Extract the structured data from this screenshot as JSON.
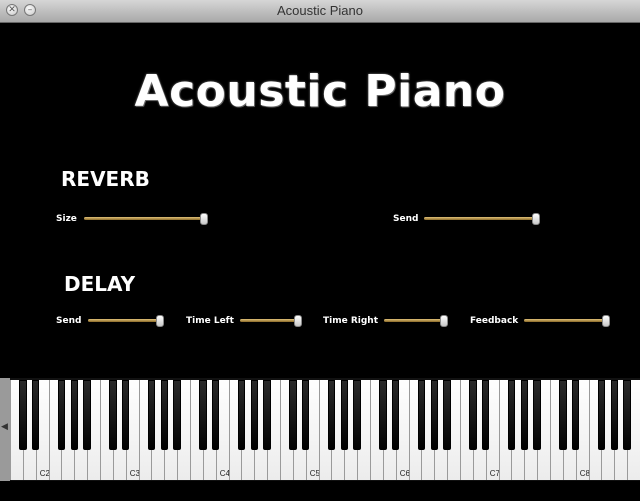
{
  "window": {
    "title": "Acoustic Piano",
    "close_symbol": "✕",
    "minimize_symbol": "–"
  },
  "header": {
    "title": "Acoustic Piano"
  },
  "reverb": {
    "title": "REVERB",
    "size": {
      "label": "Size",
      "value": 1.0
    },
    "send": {
      "label": "Send",
      "value": 1.0
    }
  },
  "delay": {
    "title": "DELAY",
    "send": {
      "label": "Send",
      "value": 1.0
    },
    "time_left": {
      "label": "Time Left",
      "value": 1.0
    },
    "time_right": {
      "label": "Time Right",
      "value": 1.0
    },
    "feedback": {
      "label": "Feedback",
      "value": 1.0
    }
  },
  "keyboard": {
    "octave_labels": [
      "C2",
      "C3",
      "C4",
      "C5",
      "C6",
      "C7",
      "C8"
    ],
    "scroll_arrow": "◀"
  },
  "colors": {
    "background": "#000000",
    "slider_track": "#c9a04a",
    "text": "#ffffff"
  }
}
